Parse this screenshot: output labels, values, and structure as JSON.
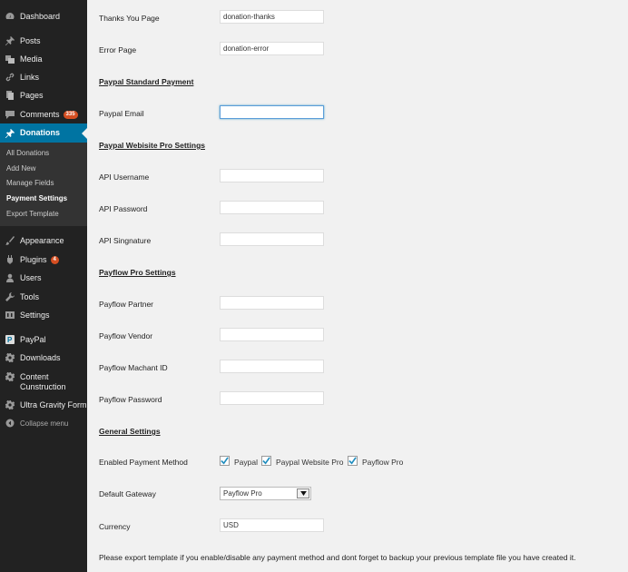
{
  "sidebar": {
    "items": [
      {
        "label": "Dashboard",
        "icon": "dashboard-icon"
      },
      {
        "label": "Posts",
        "icon": "pushpin-icon"
      },
      {
        "label": "Media",
        "icon": "media-icon"
      },
      {
        "label": "Links",
        "icon": "link-icon"
      },
      {
        "label": "Pages",
        "icon": "pages-icon"
      },
      {
        "label": "Comments",
        "icon": "comment-icon",
        "badge": "335"
      },
      {
        "label": "Donations",
        "icon": "pushpin-icon"
      },
      {
        "label": "Appearance",
        "icon": "paintbrush-icon"
      },
      {
        "label": "Plugins",
        "icon": "plugin-icon",
        "badge": "4"
      },
      {
        "label": "Users",
        "icon": "users-icon"
      },
      {
        "label": "Tools",
        "icon": "wrench-icon"
      },
      {
        "label": "Settings",
        "icon": "settings-icon"
      },
      {
        "label": "PayPal",
        "icon": "paypal-icon"
      },
      {
        "label": "Downloads",
        "icon": "gear-icon"
      },
      {
        "label": "Content Cunstruction",
        "icon": "gear-icon"
      },
      {
        "label": "Ultra Gravity Form",
        "icon": "gear-icon"
      },
      {
        "label": "Collapse menu",
        "icon": "collapse-icon"
      }
    ],
    "submenu": [
      "All Donations",
      "Add New",
      "Manage Fields",
      "Payment Settings",
      "Export Template"
    ]
  },
  "form": {
    "thanks_page_label": "Thanks You Page",
    "thanks_page_value": "donation-thanks",
    "error_page_label": "Error Page",
    "error_page_value": "donation-error",
    "paypal_standard_title": "Paypal Standard Payment",
    "paypal_email_label": "Paypal Email",
    "paypal_email_value": "",
    "website_pro_title": "Paypal Webisite Pro Settings",
    "api_username_label": "API Username",
    "api_password_label": "API Password",
    "api_signature_label": "API Singnature",
    "payflow_title": "Payflow Pro Settings",
    "payflow_partner_label": "Payflow Partner",
    "payflow_vendor_label": "Payflow Vendor",
    "payflow_merchant_label": "Payflow Machant ID",
    "payflow_password_label": "Payflow Password",
    "general_title": "General Settings",
    "enabled_methods_label": "Enabled Payment Method",
    "method_paypal": "Paypal",
    "method_website_pro": "Paypal Website Pro",
    "method_payflow": "Payflow Pro",
    "default_gateway_label": "Default Gateway",
    "default_gateway_value": "Payflow Pro",
    "currency_label": "Currency",
    "currency_value": "USD",
    "note": "Please export template if you enable/disable any payment method and dont forget to backup your previous template file you have created it."
  },
  "colors": {
    "sidebar_bg": "#222222",
    "active_bg": "#0074a2",
    "badge_bg": "#d54e21",
    "content_bg": "#f1f1f1"
  }
}
